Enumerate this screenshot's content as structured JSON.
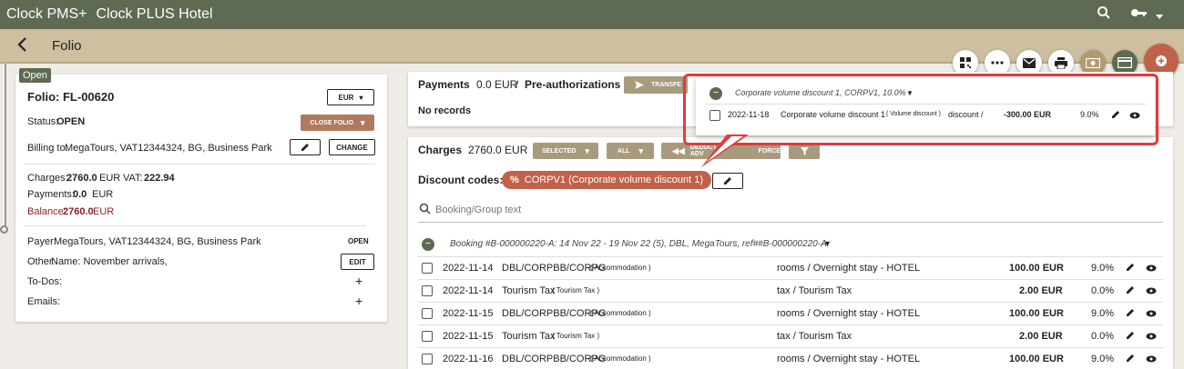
{
  "topbar": {
    "brand": "Clock PMS+",
    "hotel": "Clock PLUS Hotel",
    "icons": [
      "search-icon",
      "key-icon",
      "chevron-down-icon"
    ]
  },
  "page": {
    "title": "Folio"
  },
  "toolbar_icons": [
    "qr-code-icon",
    "more-icon",
    "mail-icon",
    "print-icon",
    "money-icon",
    "card-icon",
    "plus-icon"
  ],
  "folio": {
    "badge": "Open",
    "title": "Folio: FL-00620",
    "currency": "EUR",
    "status_label": "Status:",
    "status_value": "OPEN",
    "close_label": "CLOSE FOLIO",
    "billing_label": "Billing to:",
    "billing_value": "MegaTours, VAT12344324, BG, Business Park",
    "change_label": "CHANGE",
    "charges_label": "Charges:",
    "charges_value": "2760.0",
    "charges_currency": "EUR",
    "vat_label": "VAT:",
    "vat_value": "222.94",
    "payments_label": "Payments:",
    "payments_value": "0.0",
    "payments_currency": "EUR",
    "balance_label": "Balance:",
    "balance_value": "2760.0",
    "balance_currency": "EUR",
    "payer_label": "Payer:",
    "payer_value": "MegaTours, VAT12344324, BG, Business Park",
    "payer_action": "OPEN",
    "other_label": "Other:",
    "other_value": "Name: November arrivals,",
    "edit_label": "EDIT",
    "todos_label": "To-Dos:",
    "emails_label": "Emails:"
  },
  "payments": {
    "title": "Payments",
    "amount": "0.0 EUR",
    "separator": "/",
    "preauth": "Pre-authorizations",
    "transfer_label": "TRANSFE",
    "empty": "No records"
  },
  "charges": {
    "title": "Charges",
    "amount": "2760.0 EUR",
    "selected_label": "SELECTED",
    "all_label": "ALL",
    "deduct_label": "DEDUCT ADV",
    "force_label": "FORCE",
    "discount_label": "Discount codes:",
    "discount_chip": "CORPV1 (Corporate volume discount 1)",
    "search_placeholder": "Booking/Group text",
    "group_header": "Booking #B-000000220-A: 14 Nov 22 - 19 Nov 22 (5), DBL, MegaTours, ref##B-000000220-A",
    "rows": [
      {
        "date": "2022-11-14",
        "name": "DBL/CORPBB/CORPG",
        "type": "( Accommodation )",
        "category": "rooms / Overnight stay - HOTEL",
        "amount": "100.00 EUR",
        "vat": "9.0%"
      },
      {
        "date": "2022-11-14",
        "name": "Tourism Tax",
        "type": "( Tourism Tax )",
        "category": "tax / Tourism Tax",
        "amount": "2.00 EUR",
        "vat": "0.0%"
      },
      {
        "date": "2022-11-15",
        "name": "DBL/CORPBB/CORPG",
        "type": "( Accommodation )",
        "category": "rooms / Overnight stay - HOTEL",
        "amount": "100.00 EUR",
        "vat": "9.0%"
      },
      {
        "date": "2022-11-15",
        "name": "Tourism Tax",
        "type": "( Tourism Tax )",
        "category": "tax / Tourism Tax",
        "amount": "2.00 EUR",
        "vat": "0.0%"
      },
      {
        "date": "2022-11-16",
        "name": "DBL/CORPBB/CORPG",
        "type": "( Accommodation )",
        "category": "rooms / Overnight stay - HOTEL",
        "amount": "100.00 EUR",
        "vat": "9.0%"
      }
    ]
  },
  "popup": {
    "group_header": "Corporate volume discount 1, CORPV1, 10.0%",
    "row": {
      "date": "2022-11-18",
      "name": "Corporate volume discount 1",
      "type": "( Volume discount )",
      "category": "discount /",
      "amount": "-300.00 EUR",
      "vat": "9.0%"
    }
  },
  "colors": {
    "topbar": "#5e6a52",
    "subbar": "#cdbf9f",
    "accent": "#c0624a",
    "highlight": "#e23b3b",
    "balance": "#8b1f1f"
  }
}
